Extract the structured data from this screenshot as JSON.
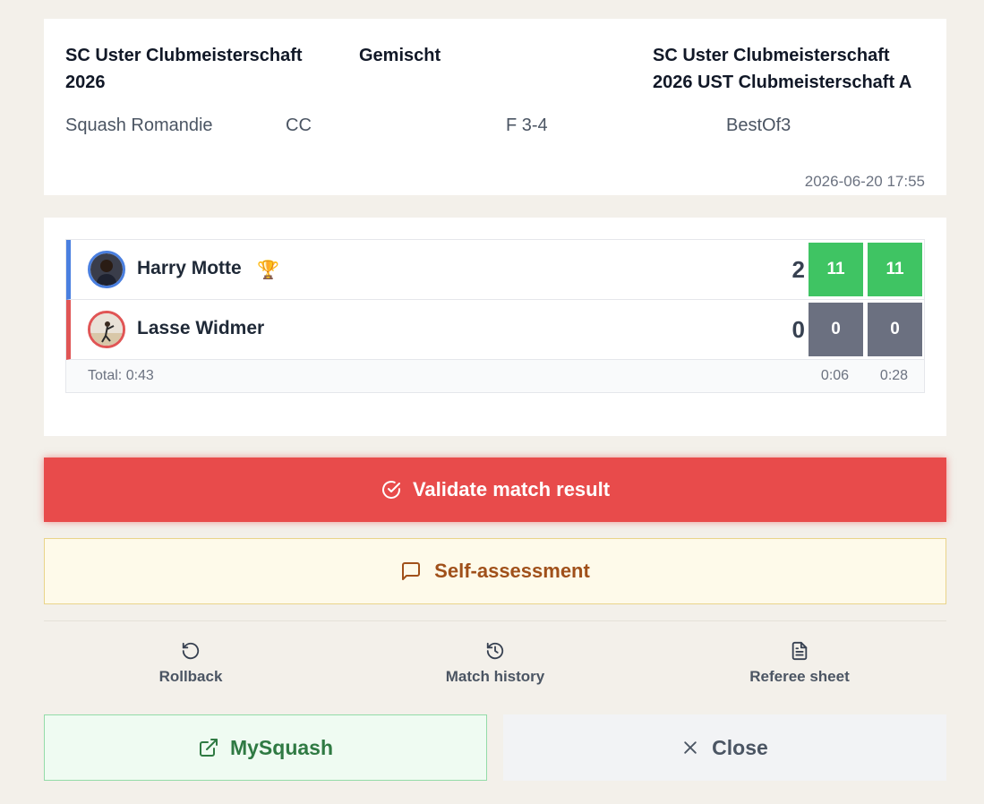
{
  "match": {
    "tournament": "SC Uster Clubmeisterschaft 2026",
    "category": "Gemischt",
    "draw": "SC Uster Clubmeisterschaft 2026 UST Clubmeisterschaft A",
    "association": "Squash Romandie",
    "type": "CC",
    "round": "F 3-4",
    "format": "BestOf3",
    "datetime": "2026-06-20 17:55"
  },
  "players": [
    {
      "name": "Harry Motte",
      "sets": "2",
      "games": [
        "11",
        "11"
      ],
      "winner": true,
      "side_color": "#4a7fdf"
    },
    {
      "name": "Lasse Widmer",
      "sets": "0",
      "games": [
        "0",
        "0"
      ],
      "winner": false,
      "side_color": "#e05555"
    }
  ],
  "totals": {
    "total_label": "Total: 0:43",
    "game_times": [
      "0:06",
      "0:28"
    ]
  },
  "buttons": {
    "validate": "Validate match result",
    "self_assessment": "Self-assessment",
    "rollback": "Rollback",
    "match_history": "Match history",
    "referee_sheet": "Referee sheet",
    "mysquash": "MySquash",
    "close": "Close"
  },
  "colors": {
    "validate": "#e84b4b",
    "win_game": "#3fc463",
    "lose_game": "#6b7080",
    "mysquash_text": "#2f7a43",
    "self_assessment_text": "#a0501a"
  }
}
